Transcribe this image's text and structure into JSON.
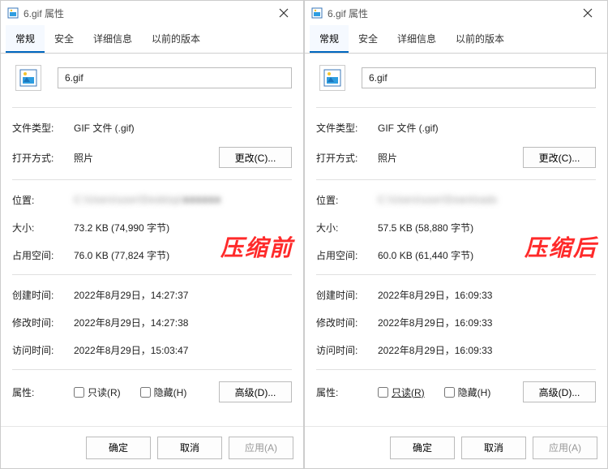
{
  "windows": [
    {
      "title": "6.gif 属性",
      "filename": "6.gif",
      "tabs": [
        "常规",
        "安全",
        "详细信息",
        "以前的版本"
      ],
      "labels": {
        "type": "文件类型:",
        "openwith": "打开方式:",
        "location": "位置:",
        "size": "大小:",
        "disksize": "占用空间:",
        "created": "创建时间:",
        "modified": "修改时间:",
        "accessed": "访问时间:",
        "attrs": "属性:"
      },
      "values": {
        "type": "GIF 文件 (.gif)",
        "openwith": "照片",
        "location": "C:\\Users\\user\\Desktop\\■■■■■■",
        "size": "73.2 KB (74,990 字节)",
        "disksize": "76.0 KB (77,824 字节)",
        "created": "2022年8月29日，14:27:37",
        "modified": "2022年8月29日，14:27:38",
        "accessed": "2022年8月29日，15:03:47"
      },
      "buttons": {
        "change": "更改(C)...",
        "advanced": "高级(D)...",
        "ok": "确定",
        "cancel": "取消",
        "apply": "应用(A)"
      },
      "checks": {
        "readonly": "只读(R)",
        "hidden": "隐藏(H)"
      },
      "stamp": "压缩前"
    },
    {
      "title": "6.gif 属性",
      "filename": "6.gif",
      "tabs": [
        "常规",
        "安全",
        "详细信息",
        "以前的版本"
      ],
      "labels": {
        "type": "文件类型:",
        "openwith": "打开方式:",
        "location": "位置:",
        "size": "大小:",
        "disksize": "占用空间:",
        "created": "创建时间:",
        "modified": "修改时间:",
        "accessed": "访问时间:",
        "attrs": "属性:"
      },
      "values": {
        "type": "GIF 文件 (.gif)",
        "openwith": "照片",
        "location": "C:\\Users\\user\\Downloads",
        "size": "57.5 KB (58,880 字节)",
        "disksize": "60.0 KB (61,440 字节)",
        "created": "2022年8月29日，16:09:33",
        "modified": "2022年8月29日，16:09:33",
        "accessed": "2022年8月29日，16:09:33"
      },
      "buttons": {
        "change": "更改(C)...",
        "advanced": "高级(D)...",
        "ok": "确定",
        "cancel": "取消",
        "apply": "应用(A)"
      },
      "checks": {
        "readonly": "只读(R)",
        "hidden": "隐藏(H)"
      },
      "stamp": "压缩后"
    }
  ]
}
